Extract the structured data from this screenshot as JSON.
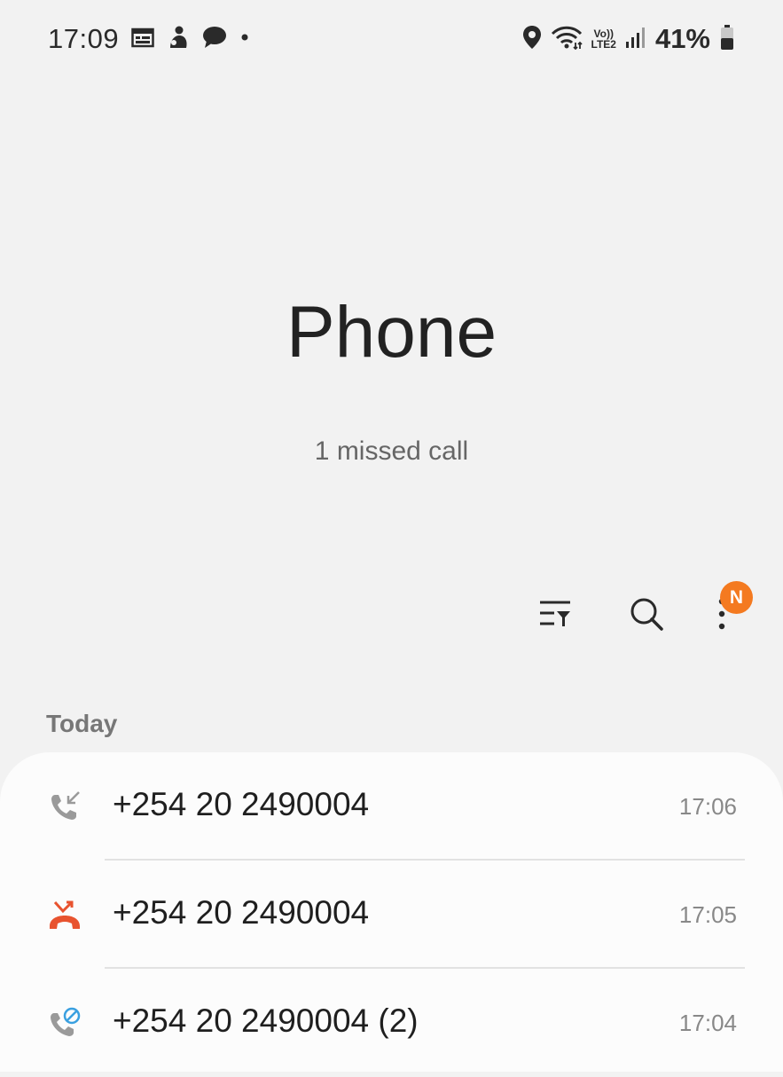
{
  "status_bar": {
    "time": "17:09",
    "battery_pct": "41%",
    "volte_top": "Vo))",
    "volte_bottom": "LTE2",
    "left_icons": [
      "calendar-icon",
      "app-notification-icon",
      "message-icon",
      "more-notifications-dot"
    ],
    "right_icons": [
      "location-icon",
      "wifi-icon",
      "volte-icon",
      "signal-icon",
      "battery-icon"
    ]
  },
  "header": {
    "title": "Phone",
    "subtitle": "1 missed call"
  },
  "toolbar": {
    "filter_icon": "filter-icon",
    "search_icon": "search-icon",
    "more_icon": "more-options-icon",
    "badge": "N",
    "badge_color": "#f47a20"
  },
  "call_log": {
    "section_label": "Today",
    "items": [
      {
        "number": "+254 20 2490004",
        "time": "17:06",
        "type": "incoming-call-icon"
      },
      {
        "number": "+254 20 2490004",
        "time": "17:05",
        "type": "missed-call-icon"
      },
      {
        "number": "+254 20 2490004 (2)",
        "time": "17:04",
        "type": "blocked-call-icon"
      }
    ]
  },
  "colors": {
    "background": "#f2f2f2",
    "card": "#fcfcfc",
    "missed": "#e8532f",
    "blocked_accent": "#3aa0e0"
  }
}
